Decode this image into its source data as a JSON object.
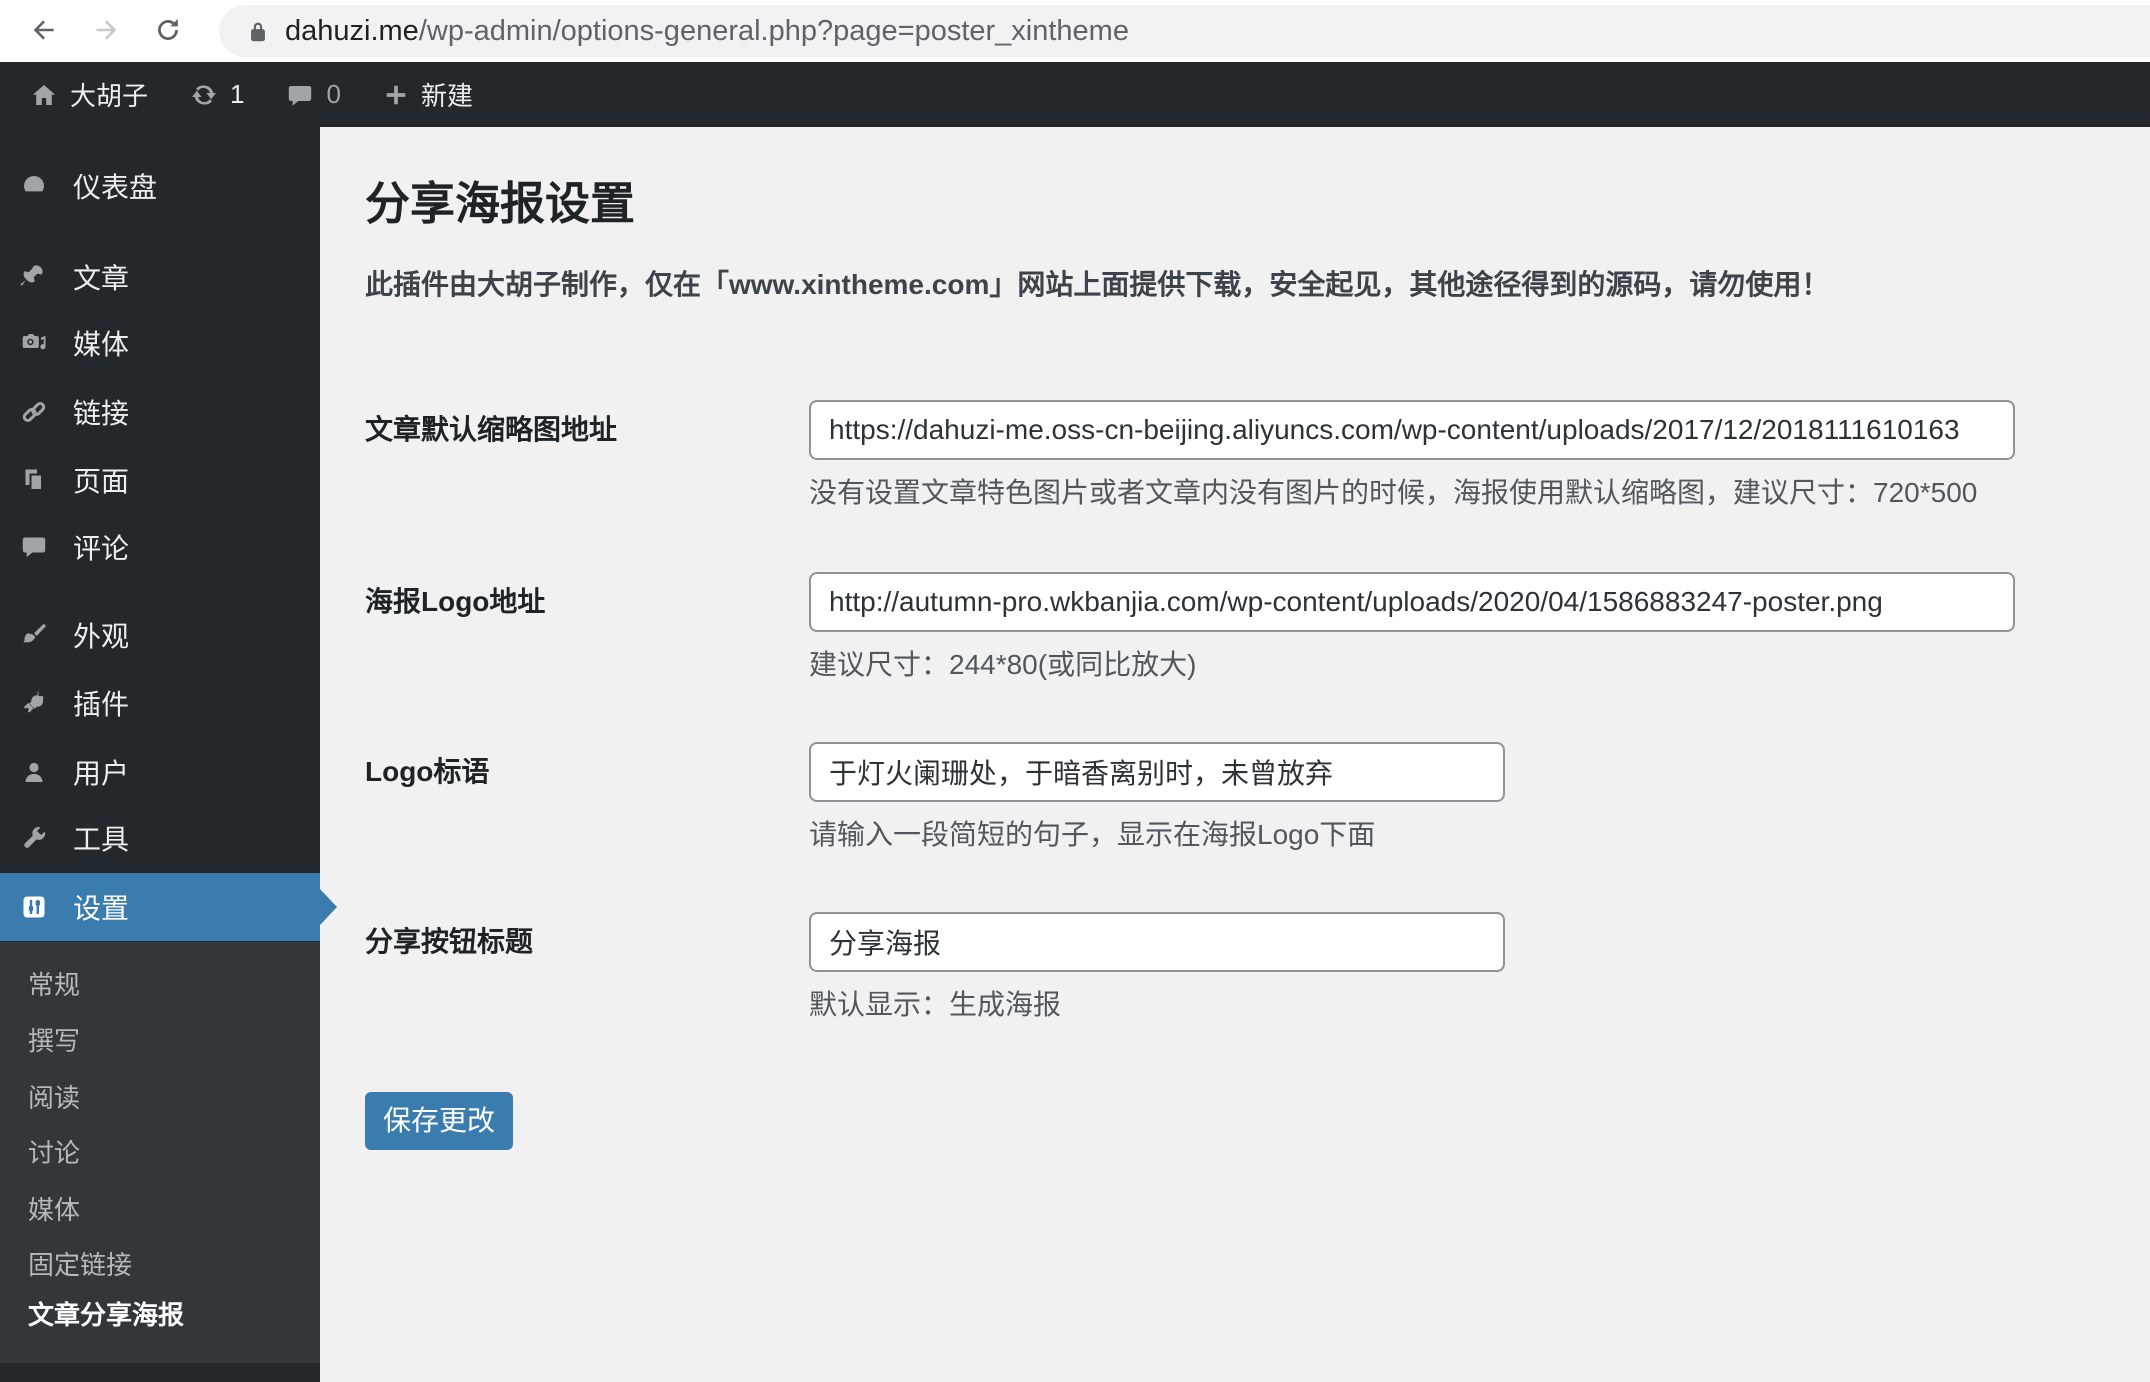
{
  "browser": {
    "url_domain": "dahuzi.me",
    "url_path": "/wp-admin/options-general.php?page=poster_xintheme"
  },
  "admin_bar": {
    "site_name": "大胡子",
    "updates_count": "1",
    "comments_count": "0",
    "new_label": "新建"
  },
  "sidebar": {
    "items": [
      {
        "label": "仪表盘"
      },
      {
        "label": "文章"
      },
      {
        "label": "媒体"
      },
      {
        "label": "链接"
      },
      {
        "label": "页面"
      },
      {
        "label": "评论"
      },
      {
        "label": "外观"
      },
      {
        "label": "插件"
      },
      {
        "label": "用户"
      },
      {
        "label": "工具"
      },
      {
        "label": "设置"
      }
    ],
    "submenu": [
      {
        "label": "常规"
      },
      {
        "label": "撰写"
      },
      {
        "label": "阅读"
      },
      {
        "label": "讨论"
      },
      {
        "label": "媒体"
      },
      {
        "label": "固定链接"
      },
      {
        "label": "文章分享海报"
      }
    ]
  },
  "main": {
    "title": "分享海报设置",
    "notice": "此插件由大胡子制作，仅在「www.xintheme.com」网站上面提供下载，安全起见，其他途径得到的源码，请勿使用！",
    "fields": [
      {
        "label": "文章默认缩略图地址",
        "value": "https://dahuzi-me.oss-cn-beijing.aliyuncs.com/wp-content/uploads/2017/12/2018111610163",
        "help": "没有设置文章特色图片或者文章内没有图片的时候，海报使用默认缩略图，建议尺寸：720*500"
      },
      {
        "label": "海报Logo地址",
        "value": "http://autumn-pro.wkbanjia.com/wp-content/uploads/2020/04/1586883247-poster.png",
        "help": "建议尺寸：244*80(或同比放大)"
      },
      {
        "label": "Logo标语",
        "value": "于灯火阑珊处，于暗香离别时，未曾放弃",
        "help": "请输入一段简短的句子，显示在海报Logo下面"
      },
      {
        "label": "分享按钮标题",
        "value": "分享海报",
        "help": "默认显示：生成海报"
      }
    ],
    "save_button": "保存更改"
  },
  "colors": {
    "accent_blue": "#3a7cae",
    "admin_dark": "#23282d",
    "submenu_dark": "#32373c",
    "content_bg": "#f1f1f1"
  }
}
